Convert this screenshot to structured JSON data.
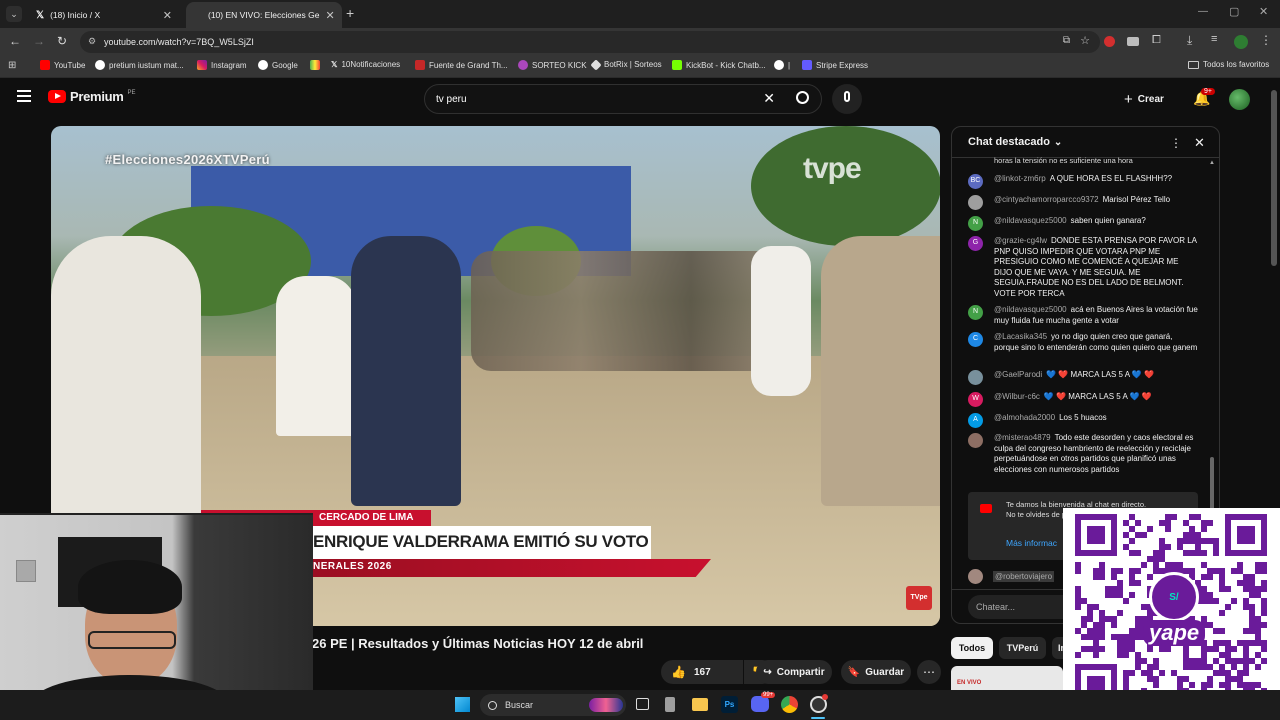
{
  "browser": {
    "tabs": [
      {
        "label": "(18) Inicio / X",
        "active": false
      },
      {
        "label": "(10) EN VIVO: Elecciones Ge",
        "active": true
      }
    ],
    "url": "youtube.com/watch?v=7BQ_W5LSjZI",
    "bookmarks": [
      "YouTube",
      "pretium iustum mat...",
      "Instagram",
      "Google",
      "",
      "10Notificaciones",
      "Fuente de Grand Th...",
      "SORTEO KICK",
      "BotRix | Sorteos",
      "KickBot - Kick Chatb...",
      "|",
      "Stripe Express"
    ],
    "all_bookmarks": "Todos los favoritos"
  },
  "youtube": {
    "logo": "Premium",
    "region": "PE",
    "search_value": "tv peru",
    "create_label": "Crear",
    "notif_count": "9+"
  },
  "video": {
    "hashtag": "#Elecciones2026XTVPerú",
    "channel_logo": "tvpe",
    "location": "CERCADO DE LIMA",
    "headline": "ENRIQUE VALDERRAMA EMITIÓ SU VOTO",
    "subline": "NERALES 2026",
    "corner_badge": "TVpe"
  },
  "below": {
    "title": "26 PE | Resultados y Últimas Noticias HOY 12 de abril",
    "likes": "167",
    "share_label": "Compartir",
    "save_label": "Guardar",
    "filters": [
      "Todos",
      "TVPerú",
      "In"
    ],
    "thumb_badge": "EN VIVO"
  },
  "chat": {
    "header": "Chat destacado",
    "top_fragment": "horas la tensión no es suficiente una hora",
    "messages": [
      {
        "author": "@linkot-zm6rp",
        "text": "A QUE HORA ES EL FLASHHH??",
        "initial": "BC",
        "color": "#5c6bc0"
      },
      {
        "author": "@cintyachamorroparcco9372",
        "text": "Marisol Pérez Tello",
        "initial": "",
        "color": "#9e9e9e"
      },
      {
        "author": "@nildavasquez5000",
        "text": "saben quien ganara?",
        "initial": "N",
        "color": "#43a047"
      },
      {
        "author": "@grazie-cg4lw",
        "text": "DONDE ESTA PRENSA POR FAVOR LA PNP QUISO IMPEDIR QUE VOTARA PNP ME PRESIGUIO COMO ME COMENCÉ A QUEJAR ME DIJO QUE ME VAYA. Y ME SEGUIA. ME SEGUIA.FRAUDE NO ES DEL LADO DE BELMONT. VOTE POR TERCA",
        "initial": "G",
        "color": "#8e24aa"
      },
      {
        "author": "@nildavasquez5000",
        "text": "acá en Buenos Aires la votación fue muy fluida fue mucha gente a votar",
        "initial": "N",
        "color": "#43a047"
      },
      {
        "author": "@Lacasika345",
        "text": "yo no digo quien creo que ganará, porque sino lo entenderán como quien quiero que ganem",
        "initial": "C",
        "color": "#1e88e5"
      },
      {
        "author": "@GaelParodi",
        "text": "💙 ❤️ MARCA LAS 5 A 💙 ❤️",
        "initial": "",
        "color": "#78909c"
      },
      {
        "author": "@Wilbur-c6c",
        "text": "💙 ❤️ MARCA LAS 5 A 💙 ❤️",
        "initial": "W",
        "color": "#d81b60"
      },
      {
        "author": "@almohada2000",
        "text": "Los 5 huacos",
        "initial": "A",
        "color": "#039be5"
      },
      {
        "author": "@misterao4879",
        "text": "Todo este desorden y caos electoral es culpa del congreso hambriento de reelección y reciclaje perpetuándose en otros partidos que planificó unas elecciones con numerosos partidos",
        "initial": "",
        "color": "#8d6e63"
      }
    ],
    "welcome": "Te damos la bienvenida al chat en directo. No te olvides de protec Normas de la Co",
    "more_info": "Más informac",
    "last_author": "@robertoviajero",
    "input_placeholder": "Chatear..."
  },
  "overlay": {
    "qr_label": "yape",
    "qr_symbol": "S/"
  },
  "taskbar": {
    "search_label": "Buscar",
    "badge": "99+"
  },
  "colors": {
    "accent_red": "#ff0000",
    "qr_purple": "#6a1b9a"
  }
}
